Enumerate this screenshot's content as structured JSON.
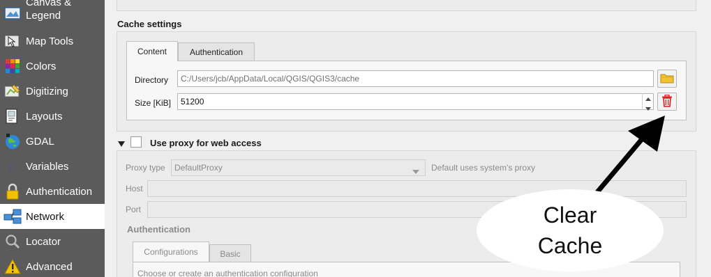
{
  "sidebar": {
    "items": [
      {
        "label": "Canvas & Legend",
        "line1": "Canvas &",
        "line2": "Legend",
        "icon": "canvas-legend-icon"
      },
      {
        "label": "Map Tools",
        "icon": "map-tools-icon"
      },
      {
        "label": "Colors",
        "icon": "colors-icon"
      },
      {
        "label": "Digitizing",
        "icon": "digitizing-icon"
      },
      {
        "label": "Layouts",
        "icon": "layouts-icon"
      },
      {
        "label": "GDAL",
        "icon": "gdal-icon"
      },
      {
        "label": "Variables",
        "icon": "variables-icon"
      },
      {
        "label": "Authentication",
        "icon": "lock-icon"
      },
      {
        "label": "Network",
        "icon": "network-icon",
        "active": true
      },
      {
        "label": "Locator",
        "icon": "search-icon"
      },
      {
        "label": "Advanced",
        "icon": "warning-icon"
      }
    ]
  },
  "cache": {
    "title": "Cache settings",
    "tabs": [
      "Content",
      "Authentication"
    ],
    "directory_label": "Directory",
    "directory_value": "C:/Users/jcb/AppData/Local/QGIS/QGIS3/cache",
    "size_label": "Size [KiB]",
    "size_value": "51200"
  },
  "proxy": {
    "checkbox_label": "Use proxy for web access",
    "checked": false,
    "type_label": "Proxy type",
    "type_value": "DefaultProxy",
    "type_hint": "Default uses system's proxy",
    "host_label": "Host",
    "port_label": "Port",
    "auth_title": "Authentication",
    "auth_tabs": [
      "Configurations",
      "Basic"
    ],
    "auth_hint": "Choose or create an authentication configuration"
  },
  "annotation": {
    "line1": "Clear",
    "line2": "Cache"
  },
  "colors": {
    "sidebar_bg": "#5b5b5b",
    "delete_red": "#d62020",
    "folder_yellow": "#f2c233"
  }
}
